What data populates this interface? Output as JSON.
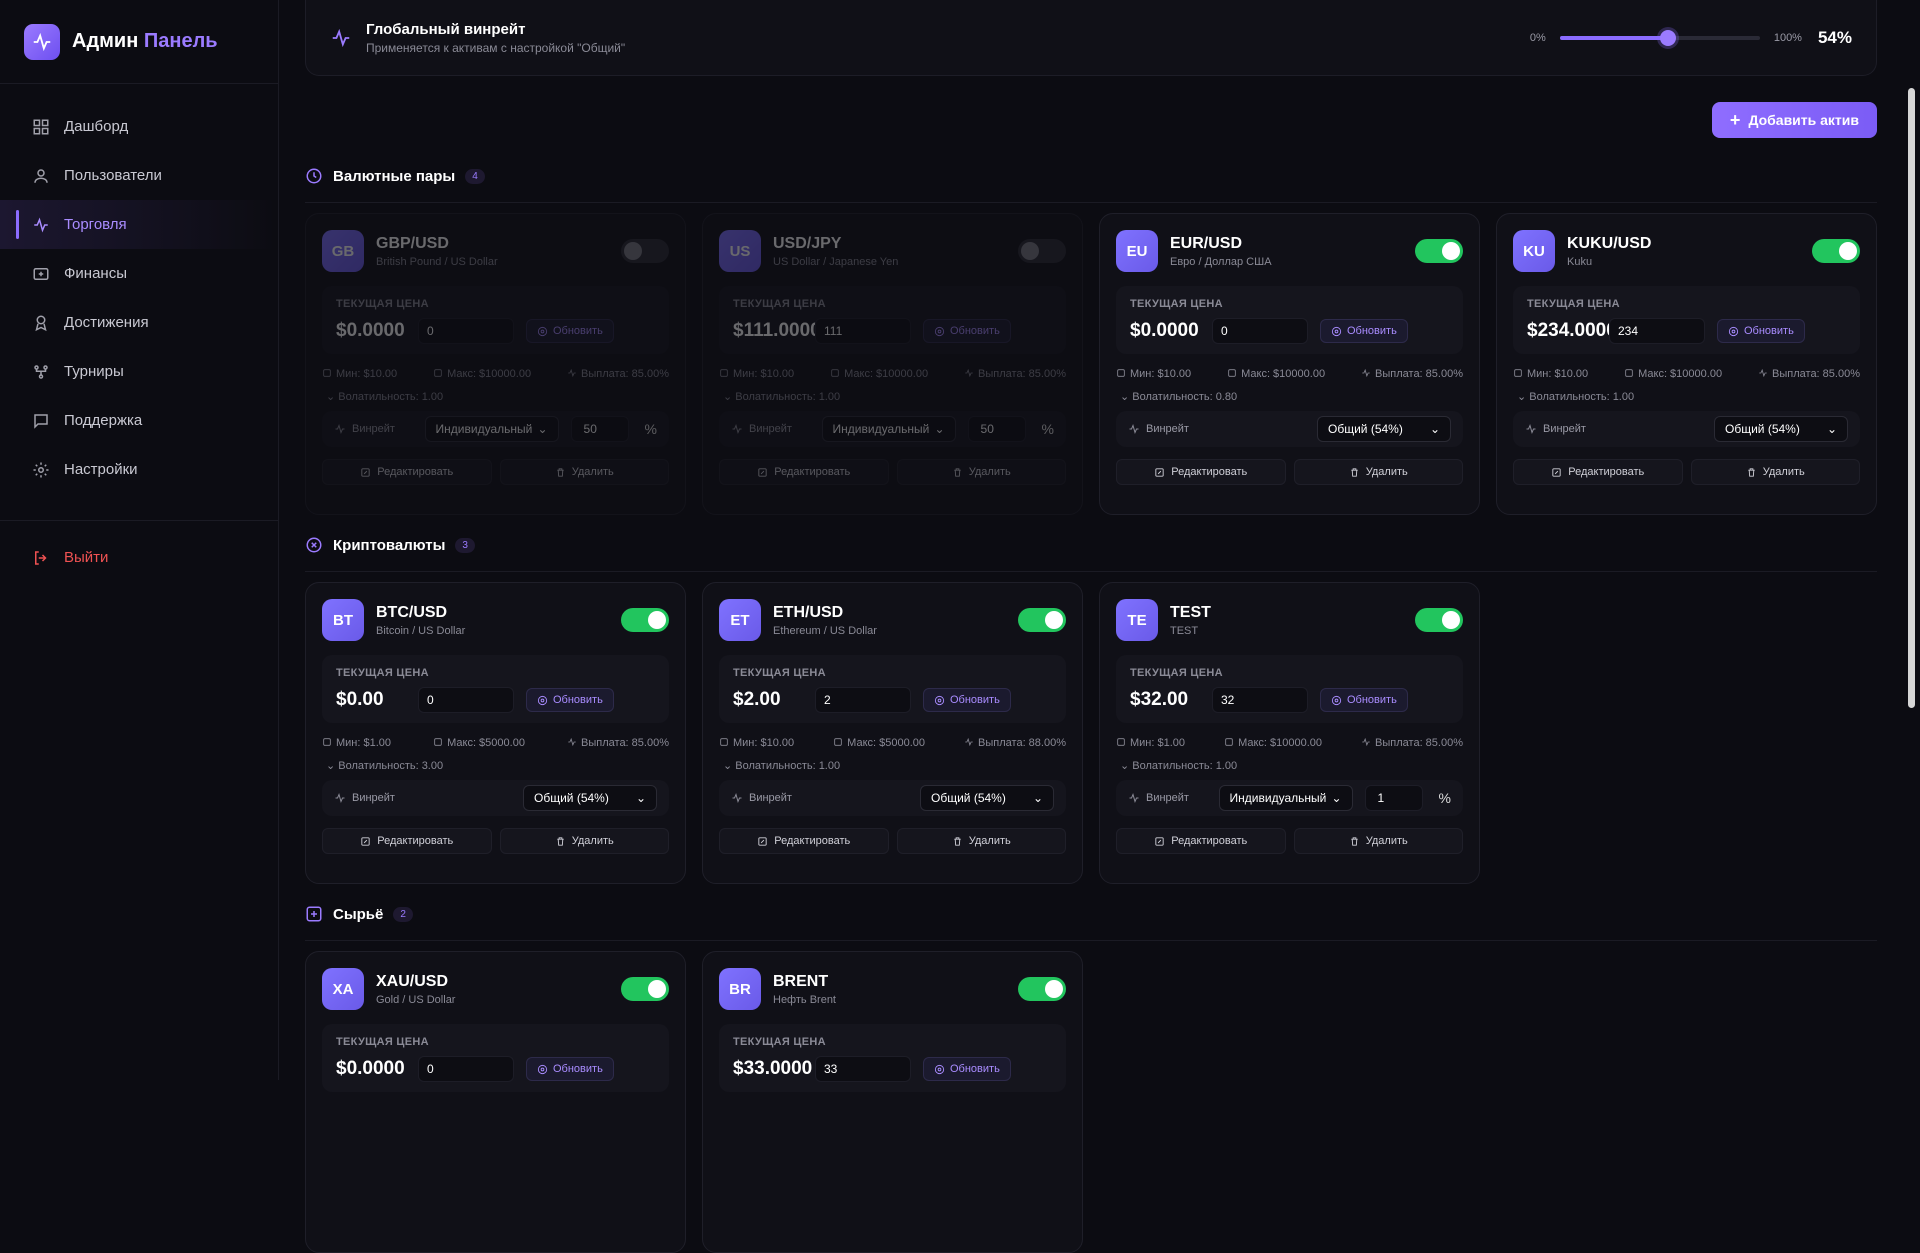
{
  "brand": {
    "title": "Админ",
    "accent": "Панель"
  },
  "nav": [
    {
      "label": "Дашборд",
      "icon": "grid-icon"
    },
    {
      "label": "Пользователи",
      "icon": "user-icon"
    },
    {
      "label": "Торговля",
      "icon": "activity-icon",
      "active": true
    },
    {
      "label": "Финансы",
      "icon": "dollar-icon"
    },
    {
      "label": "Достижения",
      "icon": "award-icon"
    },
    {
      "label": "Турниры",
      "icon": "trophy-icon"
    },
    {
      "label": "Поддержка",
      "icon": "message-icon"
    },
    {
      "label": "Настройки",
      "icon": "gear-icon"
    }
  ],
  "logout": "Выйти",
  "global": {
    "title": "Глобальный винрейт",
    "subtitle": "Применяется к активам с настройкой \"Общий\"",
    "min": "0%",
    "max": "100%",
    "value": "54%",
    "level": 0.54
  },
  "add_button": "Добавить актив",
  "labels": {
    "current_price": "ТЕКУЩАЯ ЦЕНА",
    "update": "Обновить",
    "winrate": "Винрейт",
    "edit": "Редактировать",
    "delete": "Удалить",
    "percent": "%"
  },
  "sections": [
    {
      "title": "Валютные пары",
      "count": "4",
      "icon": "clock-icon",
      "cards": [
        {
          "code": "GB",
          "name": "GBP/USD",
          "desc": "British Pound / US Dollar",
          "enabled": false,
          "price": "$0.0000",
          "input": "0",
          "min": "Мин: $10.00",
          "max": "Макс: $10000.00",
          "payout": "Выплата: 85.00%",
          "vol": "Волатильность: 1.00",
          "mode": "Индивидуальный",
          "wr": "50"
        },
        {
          "code": "US",
          "name": "USD/JPY",
          "desc": "US Dollar / Japanese Yen",
          "enabled": false,
          "price": "$111.0000",
          "input": "111",
          "min": "Мин: $10.00",
          "max": "Макс: $10000.00",
          "payout": "Выплата: 85.00%",
          "vol": "Волатильность: 1.00",
          "mode": "Индивидуальный",
          "wr": "50"
        },
        {
          "code": "EU",
          "name": "EUR/USD",
          "desc": "Евро / Доллар США",
          "enabled": true,
          "price": "$0.0000",
          "input": "0",
          "min": "Мин: $10.00",
          "max": "Макс: $10000.00",
          "payout": "Выплата: 85.00%",
          "vol": "Волатильность: 0.80",
          "mode": "Общий (54%)"
        },
        {
          "code": "KU",
          "name": "KUKU/USD",
          "desc": "Kuku",
          "enabled": true,
          "price": "$234.0000",
          "input": "234",
          "min": "Мин: $10.00",
          "max": "Макс: $10000.00",
          "payout": "Выплата: 85.00%",
          "vol": "Волатильность: 1.00",
          "mode": "Общий (54%)"
        }
      ]
    },
    {
      "title": "Криптовалюты",
      "count": "3",
      "icon": "x-circle-icon",
      "cards": [
        {
          "code": "BT",
          "name": "BTC/USD",
          "desc": "Bitcoin / US Dollar",
          "enabled": true,
          "price": "$0.00",
          "input": "0",
          "min": "Мин: $1.00",
          "max": "Макс: $5000.00",
          "payout": "Выплата: 85.00%",
          "vol": "Волатильность: 3.00",
          "mode": "Общий (54%)"
        },
        {
          "code": "ET",
          "name": "ETH/USD",
          "desc": "Ethereum / US Dollar",
          "enabled": true,
          "price": "$2.00",
          "input": "2",
          "min": "Мин: $10.00",
          "max": "Макс: $5000.00",
          "payout": "Выплата: 88.00%",
          "vol": "Волатильность: 1.00",
          "mode": "Общий (54%)"
        },
        {
          "code": "TE",
          "name": "TEST",
          "desc": "TEST",
          "enabled": true,
          "price": "$32.00",
          "input": "32",
          "min": "Мин: $1.00",
          "max": "Макс: $10000.00",
          "payout": "Выплата: 85.00%",
          "vol": "Волатильность: 1.00",
          "mode": "Индивидуальный",
          "wr": "1"
        }
      ]
    },
    {
      "title": "Сырьё",
      "count": "2",
      "icon": "plus-square-icon",
      "cards": [
        {
          "code": "XA",
          "name": "XAU/USD",
          "desc": "Gold / US Dollar",
          "enabled": true,
          "price": "$0.0000",
          "input": "0"
        },
        {
          "code": "BR",
          "name": "BRENT",
          "desc": "Нефть Brent",
          "enabled": true,
          "price": "$33.0000",
          "input": "33"
        }
      ]
    }
  ]
}
